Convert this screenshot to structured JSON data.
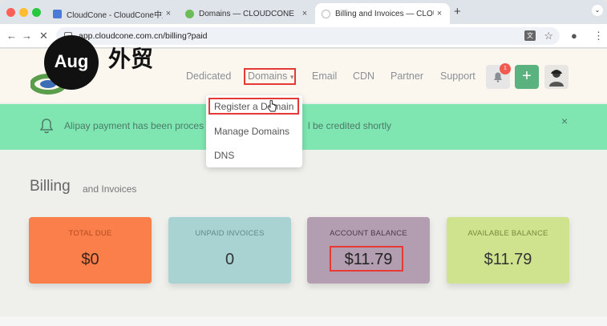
{
  "browser": {
    "tabs": [
      {
        "title": "CloudCone - CloudCone中文网",
        "icon_color": "#4a7bd6"
      },
      {
        "title": "Domains — CLOUDCONE",
        "icon_color": "#6dbb5a"
      },
      {
        "title": "Billing and Invoices — CLOUDCONE",
        "icon_color": "#cccccc"
      }
    ],
    "new_tab": "+",
    "url": "app.cloudcone.com.cn/billing?paid",
    "translate_icon": "translate-icon",
    "bookmark_icon": "star-icon",
    "menu_icon": "⋮"
  },
  "watermark": {
    "badge": "Aug",
    "text": "外贸"
  },
  "header": {
    "nav": [
      "Dedicated",
      "Domains",
      "Email",
      "CDN",
      "Partner",
      "Support"
    ],
    "domains_caret": "▾",
    "notification_count": "1",
    "add_label": "+"
  },
  "dropdown": {
    "items": [
      "Register a Domain",
      "Manage Domains",
      "DNS"
    ]
  },
  "alert": {
    "text_left": "Alipay payment has been proces",
    "text_right": "l be credited shortly",
    "close": "×"
  },
  "billing": {
    "title": "Billing",
    "subtitle": "and Invoices"
  },
  "cards": [
    {
      "label": "TOTAL DUE",
      "value": "$0",
      "bg": "#fb7f4b",
      "label_color": "#b14a20",
      "value_color": "#3b2418"
    },
    {
      "label": "UNPAID INVOICES",
      "value": "0",
      "bg": "#a9d2d2",
      "label_color": "#5e8a8a",
      "value_color": "#333333"
    },
    {
      "label": "ACCOUNT BALANCE",
      "value": "$11.79",
      "bg": "#b39db1",
      "label_color": "#4a3a4a",
      "value_color": "#222222"
    },
    {
      "label": "AVAILABLE BALANCE",
      "value": "$11.79",
      "bg": "#cfe38f",
      "label_color": "#77893a",
      "value_color": "#333333"
    }
  ],
  "colors": {
    "accent_red": "#e53935",
    "alert_green": "#7fe6b1",
    "plus_green": "#5ab37e"
  }
}
